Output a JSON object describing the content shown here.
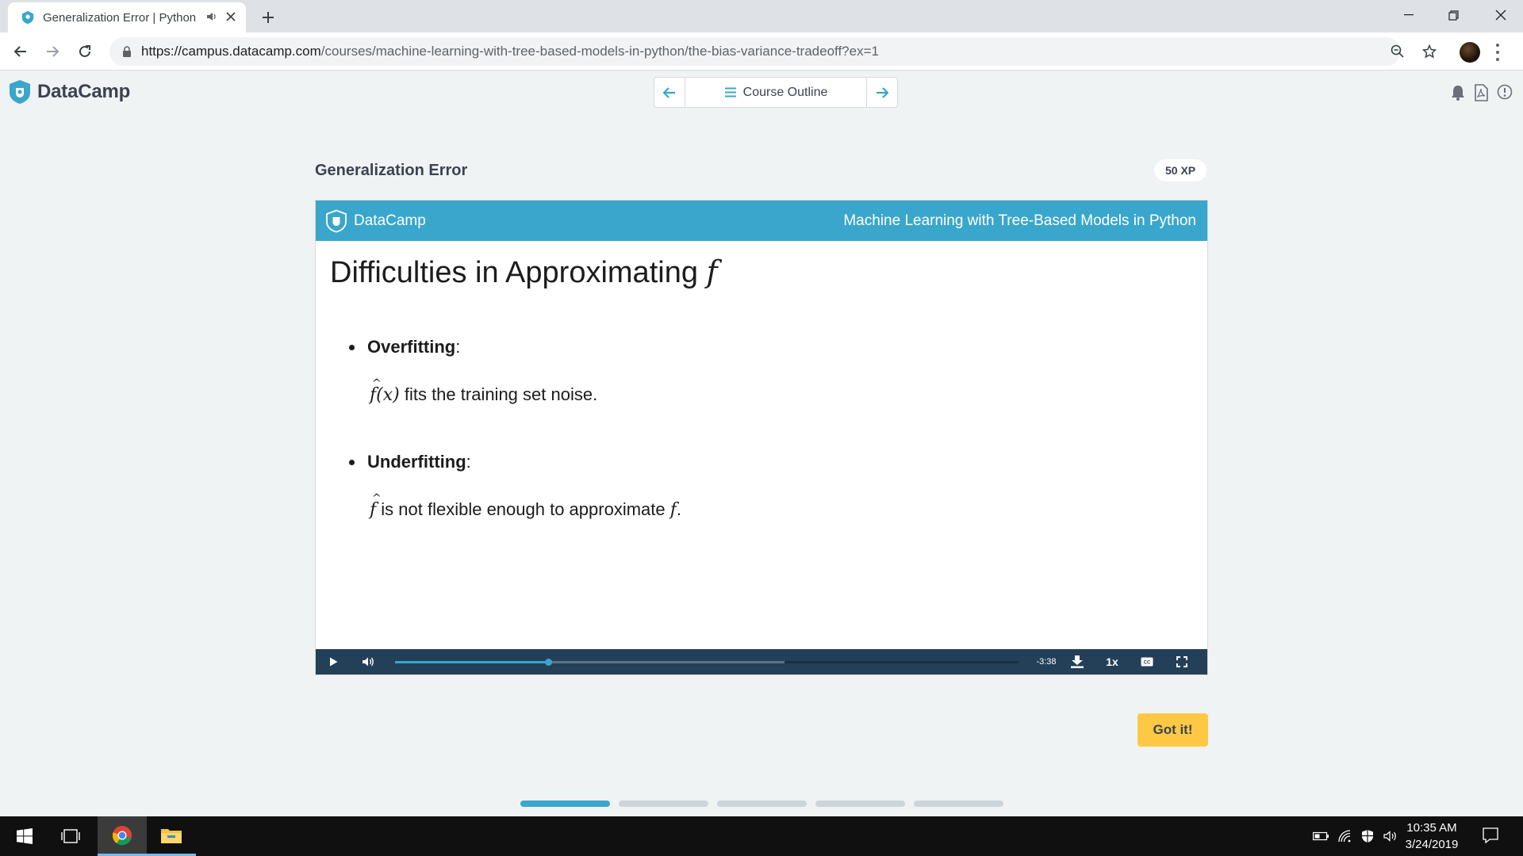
{
  "browser": {
    "tab_title": "Generalization Error | Python",
    "url_host": "https://campus.datacamp.com",
    "url_path": "/courses/machine-learning-with-tree-based-models-in-python/the-bias-variance-tradeoff?ex=1",
    "icons": [
      "datacamp-favicon",
      "speaker-icon",
      "close-icon",
      "plus-icon",
      "minimize-icon",
      "restore-icon",
      "close-window-icon",
      "back-arrow-icon",
      "forward-arrow-icon",
      "reload-icon",
      "lock-icon",
      "zoom-icon",
      "star-icon",
      "avatar",
      "kebab-menu-icon"
    ]
  },
  "header": {
    "brand": "DataCamp",
    "course_outline": "Course Outline",
    "icons": [
      "left-arrow-icon",
      "hamburger-icon",
      "right-arrow-icon",
      "bell-icon",
      "pdf-icon",
      "info-icon"
    ]
  },
  "exercise": {
    "title": "Generalization Error",
    "xp": "50 XP",
    "got_it": "Got it!"
  },
  "slide": {
    "brand": "DataCamp",
    "course": "Machine Learning with Tree-Based Models in Python",
    "heading": "Difficulties in Approximating",
    "heading_math": "f",
    "bullets": [
      {
        "term": "Overfitting",
        "colon": ":",
        "math": "f(x)",
        "text": "fits the training set noise."
      },
      {
        "term": "Underfitting",
        "colon": ":",
        "math": "f",
        "text": "is not flexible enough to approximate",
        "math2": "f",
        "end": "."
      }
    ]
  },
  "player": {
    "time": "-3:38",
    "speed": "1x",
    "played_fraction": 0.245,
    "buffered_fraction": 0.625,
    "icons": [
      "play-icon",
      "volume-icon",
      "download-icon",
      "captions-icon",
      "fullscreen-icon"
    ]
  },
  "progress": {
    "total": 5,
    "current": 1
  },
  "taskbar": {
    "time": "10:35 AM",
    "date": "3/24/2019",
    "icons": [
      "windows-start-icon",
      "task-view-icon",
      "chrome-icon",
      "file-explorer-icon",
      "battery-icon",
      "wifi-icon",
      "shield-icon",
      "speaker-icon",
      "notification-icon"
    ]
  },
  "colors": {
    "accent": "#3aa6cc",
    "player_bar": "#243f58",
    "got_it": "#ffc844",
    "page_bg": "#f0f3f4",
    "text": "#3d4251"
  }
}
